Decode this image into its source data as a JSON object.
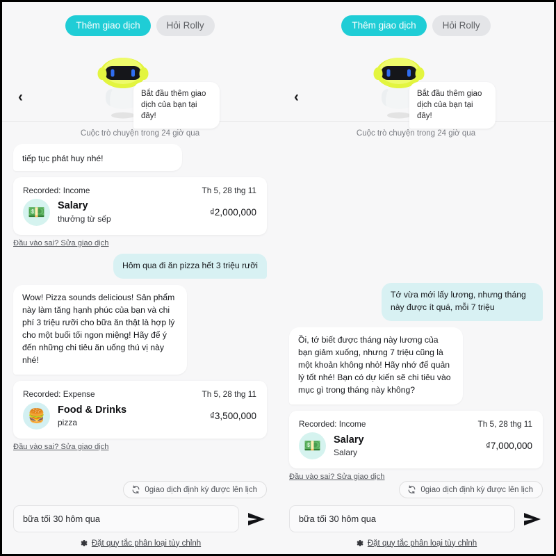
{
  "panels": [
    {
      "id": "left",
      "tabs": {
        "active_label": "Thêm giao dịch",
        "inactive_label": "Hỏi Rolly"
      },
      "back_icon": "‹",
      "hero": {
        "speech_text": "Bắt đầu thêm giao dịch của bạn tại đây!",
        "robot_name": "rolly-robot-mascot"
      },
      "session_label": "Cuộc trò chuyện trong 24 giờ qua",
      "messages": [
        {
          "type": "bot_clipped",
          "text": "tiếp tục phát huy nhé!"
        },
        {
          "type": "transaction",
          "header": "Recorded: Income",
          "date": "Th 5, 28 thg 11",
          "icon": "money-bundle-icon",
          "emoji": "💵",
          "title": "Salary",
          "note": "thưởng từ sếp",
          "amount": "₫2,000,000",
          "edit_label": "Đầu vào sai? Sửa giao dịch"
        },
        {
          "type": "user",
          "text": "Hôm qua đi ăn pizza hết 3 triệu rưỡi"
        },
        {
          "type": "bot",
          "text": "Wow! Pizza sounds delicious! Sản phẩm này làm tăng hạnh phúc của bạn và chi phí 3 triệu rưỡi cho bữa ăn thật là hợp lý cho một buổi tối ngon miệng! Hãy để ý đến những chi tiêu ăn uống thú vị này nhé!"
        },
        {
          "type": "transaction",
          "header": "Recorded: Expense",
          "date": "Th 5, 28 thg 11",
          "icon": "hamburger-icon",
          "emoji": "🍔",
          "title": "Food & Drinks",
          "note": "pizza",
          "amount": "₫3,500,000",
          "edit_label": "Đầu vào sai? Sửa giao dịch"
        }
      ],
      "footer": {
        "recurring_icon": "refresh-cycle-icon",
        "recurring_label": "0giao dịch định kỳ được lên lịch",
        "input_value": "bữa tối 30 hôm qua",
        "input_placeholder": "bữa tối 30 hôm qua",
        "send_icon": "send-arrow-icon",
        "rule_icon": "gear-icon",
        "rule_label": "Đặt quy tắc phân loại tùy chỉnh"
      }
    },
    {
      "id": "right",
      "tabs": {
        "active_label": "Thêm giao dịch",
        "inactive_label": "Hỏi Rolly"
      },
      "back_icon": "‹",
      "hero": {
        "speech_text": "Bắt đầu thêm giao dịch của bạn tại đây!",
        "robot_name": "rolly-robot-mascot"
      },
      "session_label": "Cuộc trò chuyện trong 24 giờ qua",
      "messages": [
        {
          "type": "user",
          "text": "Tớ vừa mới lấy lương, nhưng tháng này được ít quá, mỗi 7 triệu"
        },
        {
          "type": "bot",
          "text": "Ồi, tớ biết được tháng này lương của bạn giảm xuống, nhưng 7 triệu cũng là một khoản không nhỏ! Hãy nhớ để quản lý tốt nhé! Bạn có dự kiến sẽ chi tiêu vào mục gì trong tháng này không?"
        },
        {
          "type": "transaction",
          "header": "Recorded: Income",
          "date": "Th 5, 28 thg 11",
          "icon": "money-bundle-icon",
          "emoji": "💵",
          "title": "Salary",
          "note": "Salary",
          "amount": "₫7,000,000",
          "edit_label": "Đầu vào sai? Sửa giao dịch"
        }
      ],
      "footer": {
        "recurring_icon": "refresh-cycle-icon",
        "recurring_label": "0giao dịch định kỳ được lên lịch",
        "input_value": "bữa tối 30 hôm qua",
        "input_placeholder": "bữa tối 30 hôm qua",
        "send_icon": "send-arrow-icon",
        "rule_icon": "gear-icon",
        "rule_label": "Đặt quy tắc phân loại tùy chỉnh"
      }
    }
  ],
  "colors": {
    "accent_teal": "#1fcdd6",
    "user_bubble": "#d8f1f3",
    "bot_bubble": "#ffffff",
    "page_bg": "#f7f7f8",
    "robot_helmet": "#d9f23a",
    "robot_eye": "#2f6df0"
  }
}
